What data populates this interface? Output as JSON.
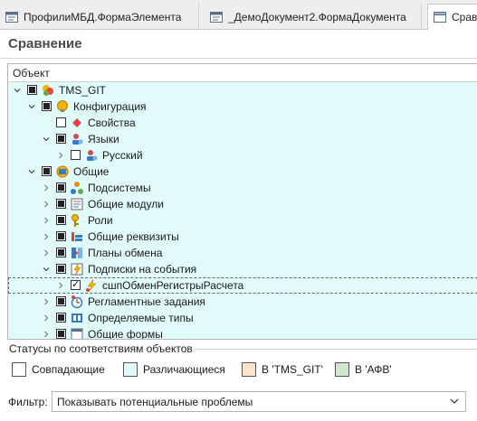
{
  "tabs": [
    {
      "label": "ПрофилиМБД.ФормаЭлемента"
    },
    {
      "label": "_ДемоДокумент2.ФормаДокумента"
    },
    {
      "label": "Сравн"
    }
  ],
  "page": {
    "title": "Сравнение"
  },
  "tree": {
    "header": "Объект",
    "rows": [
      {
        "label": "TMS_GIT",
        "icon": "config-root-icon"
      },
      {
        "label": "Конфигурация",
        "icon": "configuration-icon"
      },
      {
        "label": "Свойства",
        "icon": "properties-icon"
      },
      {
        "label": "Языки",
        "icon": "languages-icon"
      },
      {
        "label": "Русский",
        "icon": "language-icon"
      },
      {
        "label": "Общие",
        "icon": "common-icon"
      },
      {
        "label": "Подсистемы",
        "icon": "subsystems-icon"
      },
      {
        "label": "Общие модули",
        "icon": "common-modules-icon"
      },
      {
        "label": "Роли",
        "icon": "roles-icon"
      },
      {
        "label": "Общие реквизиты",
        "icon": "common-attributes-icon"
      },
      {
        "label": "Планы обмена",
        "icon": "exchange-plans-icon"
      },
      {
        "label": "Подписки на события",
        "icon": "event-subscriptions-icon"
      },
      {
        "label": "сшпОбменРегистрыРасчета",
        "icon": "event-subscription-icon"
      },
      {
        "label": "Регламентные задания",
        "icon": "scheduled-jobs-icon"
      },
      {
        "label": "Определяемые типы",
        "icon": "defined-types-icon"
      },
      {
        "label": "Общие формы",
        "icon": "common-forms-icon"
      }
    ]
  },
  "legend": {
    "title": "Статусы по соответствиям объектов",
    "items": [
      {
        "label": "Совпадающие",
        "color": "#ffffff"
      },
      {
        "label": "Различающиеся",
        "color": "#e1fbfb"
      },
      {
        "label": "В 'TMS_GIT'",
        "color": "#fbe3cc"
      },
      {
        "label": "В 'АФВ'",
        "color": "#cfe6cf"
      }
    ]
  },
  "filter": {
    "label": "Фильтр:",
    "value": "Показывать потенциальные проблемы"
  },
  "colors": {
    "differs": "#e1fbfb",
    "accent": "#f2a900"
  }
}
